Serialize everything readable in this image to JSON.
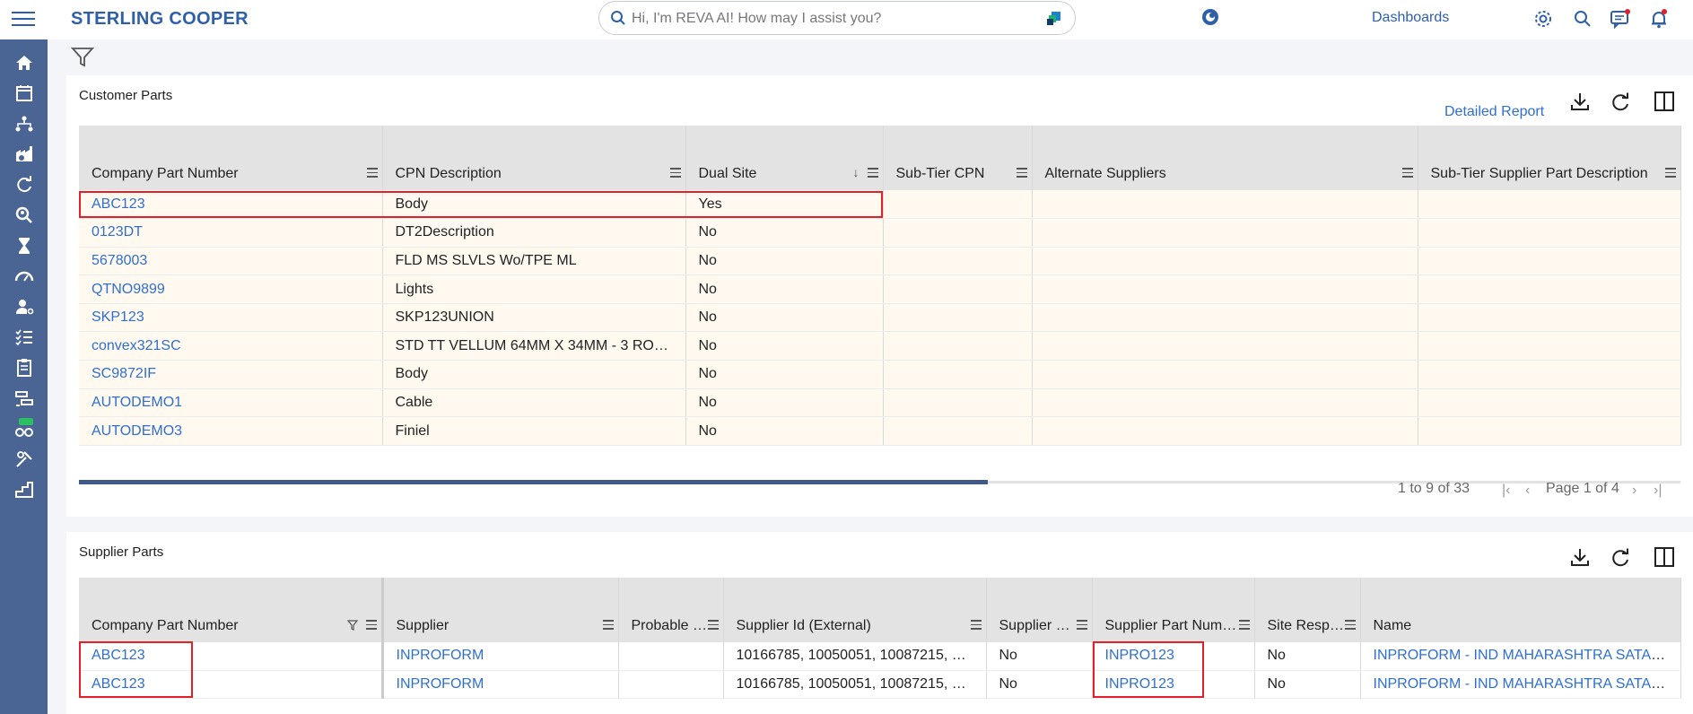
{
  "app": {
    "brand": "STERLING COOPER"
  },
  "search": {
    "placeholder": "Hi, I'm REVA AI! How may I assist you?"
  },
  "topnav": {
    "dashboards_label": "Dashboards"
  },
  "customer_parts": {
    "title": "Customer Parts",
    "detailed_report_label": "Detailed Report",
    "columns": [
      "Company Part Number",
      "CPN Description",
      "Dual Site",
      "Sub-Tier CPN",
      "Alternate Suppliers",
      "Sub-Tier Supplier Part Description"
    ],
    "rows": [
      {
        "cpn": "ABC123",
        "desc": "Body",
        "dual": "Yes"
      },
      {
        "cpn": "0123DT",
        "desc": "DT2Description",
        "dual": "No"
      },
      {
        "cpn": "5678003",
        "desc": "FLD MS SLVLS Wo/TPE ML",
        "dual": "No"
      },
      {
        "cpn": "QTNO9899",
        "desc": "Lights",
        "dual": "No"
      },
      {
        "cpn": "SKP123",
        "desc": "SKP123UNION",
        "dual": "No"
      },
      {
        "cpn": "convex321SC",
        "desc": "STD TT VELLUM 64MM X 34MM - 3 ROLL…",
        "dual": "No"
      },
      {
        "cpn": "SC9872IF",
        "desc": "Body",
        "dual": "No"
      },
      {
        "cpn": "AUTODEMO1",
        "desc": "Cable",
        "dual": "No"
      },
      {
        "cpn": "AUTODEMO3",
        "desc": "Finiel",
        "dual": "No"
      }
    ],
    "pager": {
      "info": "1 to 9 of 33",
      "page": "Page 1 of 4"
    }
  },
  "supplier_parts": {
    "title": "Supplier Parts",
    "columns": [
      "Company Part Number",
      "Supplier",
      "Probable …",
      "Supplier Id (External)",
      "Supplier R…",
      "Supplier Part Numb…",
      "Site Resp…",
      "Name"
    ],
    "rows": [
      {
        "cpn": "ABC123",
        "supplier": "INPROFORM",
        "probable": "",
        "ext_id": "10166785, 10050051, 10087215, 10…",
        "supplier_r": "No",
        "spn": "INPRO123",
        "site_resp": "No",
        "name": "INPROFORM - IND MAHARASHTRA SATARA"
      },
      {
        "cpn": "ABC123",
        "supplier": "INPROFORM",
        "probable": "",
        "ext_id": "10166785, 10050051, 10087215, 10…",
        "supplier_r": "No",
        "spn": "INPRO123",
        "site_resp": "No",
        "name": "INPROFORM - IND MAHARASHTRA SATARA"
      }
    ]
  },
  "colors": {
    "brand": "#2f5fa8",
    "sidebar": "#4a6594",
    "link": "#2f6fd2",
    "highlight": "#e0202a",
    "row_tint": "#fff9ef"
  }
}
